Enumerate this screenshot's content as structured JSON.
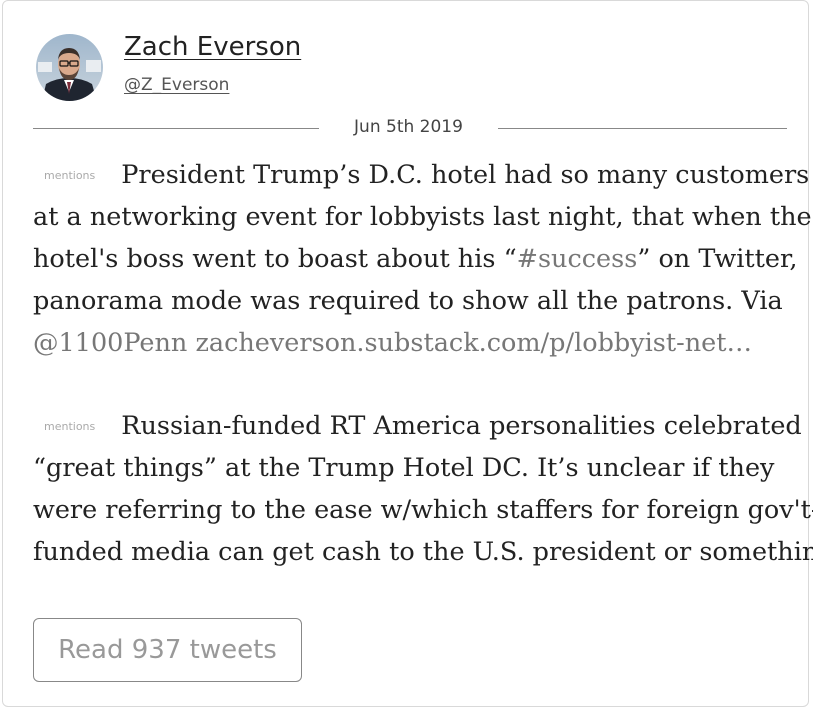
{
  "author": {
    "name": "Zach Everson",
    "handle": "@Z_Everson",
    "avatar_icon": "profile-photo"
  },
  "date": "Jun 5th 2019",
  "tweets": [
    {
      "badge": "mentions",
      "lines": [
        {
          "text": "President Trump’s D.C. hotel had so many customers"
        },
        {
          "text": "at a networking event for lobbyists last night, that when the"
        },
        {
          "before": "hotel's boss went to boast about his “",
          "link": "#success",
          "after": "” on Twitter,"
        },
        {
          "text": "panorama mode was required to show all the patrons. Via"
        },
        {
          "link": "@1100Penn zacheverson.substack.com/p/lobbyist-net…"
        }
      ]
    },
    {
      "badge": "mentions",
      "lines": [
        {
          "text": "Russian-funded RT America personalities celebrated"
        },
        {
          "text": "“great things” at the Trump Hotel DC. It’s unclear if they"
        },
        {
          "text": "were referring to the ease w/which staffers for foreign gov't-"
        },
        {
          "text": "funded media can get cash to the U.S. president or something"
        }
      ]
    }
  ],
  "read_button": "Read 937 tweets",
  "colors": {
    "text": "#222222",
    "muted_link": "#777777",
    "border": "#d9d9d9"
  }
}
